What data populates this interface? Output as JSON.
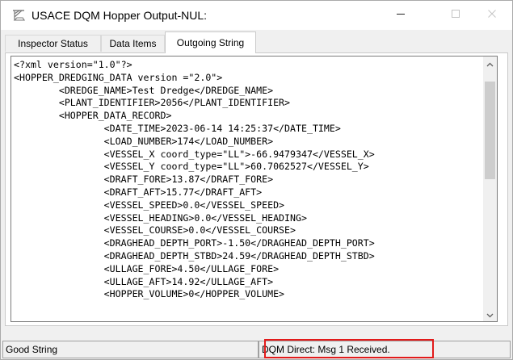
{
  "window": {
    "title": "USACE DQM Hopper Output-NUL:",
    "icon": "hopper-dredge-icon"
  },
  "tabs": [
    {
      "label": "Inspector Status",
      "selected": false
    },
    {
      "label": "Data Items",
      "selected": false
    },
    {
      "label": "Outgoing String",
      "selected": true
    }
  ],
  "outgoing_string": {
    "lines": [
      "<?xml version=\"1.0\"?>",
      "<HOPPER_DREDGING_DATA version =\"2.0\">",
      "        <DREDGE_NAME>Test Dredge</DREDGE_NAME>",
      "        <PLANT_IDENTIFIER>2056</PLANT_IDENTIFIER>",
      "        <HOPPER_DATA_RECORD>",
      "                <DATE_TIME>2023-06-14 14:25:37</DATE_TIME>",
      "                <LOAD_NUMBER>174</LOAD_NUMBER>",
      "                <VESSEL_X coord_type=\"LL\">-66.9479347</VESSEL_X>",
      "                <VESSEL_Y coord_type=\"LL\">60.7062527</VESSEL_Y>",
      "                <DRAFT_FORE>13.87</DRAFT_FORE>",
      "                <DRAFT_AFT>15.77</DRAFT_AFT>",
      "                <VESSEL_SPEED>0.0</VESSEL_SPEED>",
      "                <VESSEL_HEADING>0.0</VESSEL_HEADING>",
      "                <VESSEL_COURSE>0.0</VESSEL_COURSE>",
      "                <DRAGHEAD_DEPTH_PORT>-1.50</DRAGHEAD_DEPTH_PORT>",
      "                <DRAGHEAD_DEPTH_STBD>24.59</DRAGHEAD_DEPTH_STBD>",
      "                <ULLAGE_FORE>4.50</ULLAGE_FORE>",
      "                <ULLAGE_AFT>14.92</ULLAGE_AFT>",
      "                <HOPPER_VOLUME>0</HOPPER_VOLUME>"
    ]
  },
  "status": {
    "left": "Good String",
    "right": "DQM Direct: Msg 1 Received."
  },
  "colors": {
    "highlight_border": "#e21b1b"
  }
}
